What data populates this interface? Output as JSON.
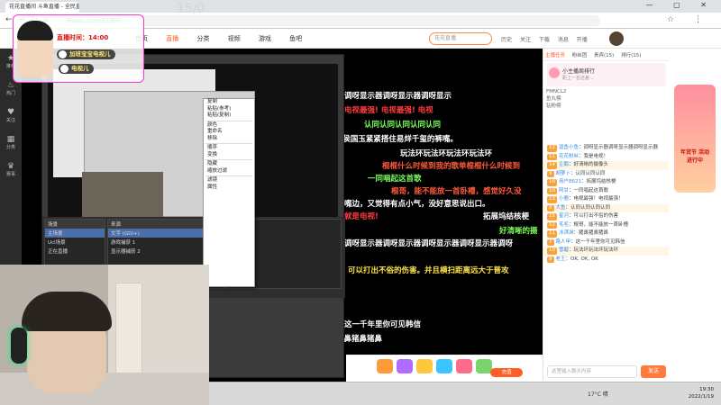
{
  "browser": {
    "tab_title": "花花直播间 斗鱼直播 - 全民直播",
    "url": "douyu.com/12306",
    "controls": "— ▢ ✕"
  },
  "site": {
    "logo": "斗鱼",
    "nav": [
      "首页",
      "直播",
      "分类",
      "视频",
      "游戏",
      "鱼吧"
    ],
    "search_placeholder": "花花直播",
    "header_icons": [
      "历史",
      "关注",
      "下载",
      "消息",
      "开播"
    ]
  },
  "rail": [
    "推荐",
    "热门",
    "关注",
    "分类",
    "赛事"
  ],
  "overlay": {
    "counter": "15/0",
    "time_label": "直播时间：14:00",
    "pill1": "加班宝宝电视儿",
    "pill2": "电视儿"
  },
  "danmu": [
    {
      "text": "调呀显示器调呀显示器调呀显示",
      "color": "#ffffff"
    },
    {
      "text": "电视最强! 电视最强! 电视",
      "color": "#ff3b3b"
    },
    {
      "text": "认同认同认同认同认同",
      "color": "#7cfc5c"
    },
    {
      "text": "\"侯国玉紧紧搭住易烊千玺的裤嘴。",
      "color": "#ffffff"
    },
    {
      "text": "玩法环玩法环玩法环玩法环",
      "color": "#ffffff"
    },
    {
      "text": "棍棍什么时候到我的歌单棍棍什么时候到",
      "color": "#ff5a3b"
    },
    {
      "text": "一同唱起这首歌",
      "color": "#7cfc5c"
    },
    {
      "text": "棍哥，能不能放一首卧槽，感觉好久没",
      "color": "#ff5a3b"
    },
    {
      "text": "嘴边，又觉得有点小气，没好意思说出口。",
      "color": "#ffffff"
    },
    {
      "text": "就是电视!",
      "color": "#ff3b3b"
    },
    {
      "text": "拓展坞结核梗",
      "color": "#ffffff"
    },
    {
      "text": "好清晰的摄",
      "color": "#7cfc5c"
    },
    {
      "text": "调呀显示器调呀显示器调呀显示器调呀显示器调呀",
      "color": "#ffffff"
    },
    {
      "text": "可以打出不俗的伤害。并且横扫距离远大于普攻",
      "color": "#ffe44d"
    },
    {
      "text": "这一千年里你可见韩信",
      "color": "#ffffff"
    },
    {
      "text": "猪鼻猪鼻猪鼻猪鼻猪鼻猪鼻猪鼻猪鼻猪鼻猪鼻",
      "color": "#ffffff"
    }
  ],
  "obs": {
    "menu_items": [
      "复制",
      "粘贴(参考)",
      "粘贴(复制)",
      "",
      "颜色",
      "重命名",
      "移除",
      "",
      "顺序",
      "变换",
      "",
      "隐藏",
      "缩放过滤",
      "",
      "滤镜",
      "属性"
    ],
    "scenes_title": "场景",
    "scenes": [
      "主场景",
      "Ucl场景",
      "正在直播"
    ],
    "sources_title": "来源",
    "sources": [
      "文字 (GDI+)",
      "游戏捕获 1",
      "显示器捕获 2"
    ]
  },
  "gifts": {
    "recharge": "充值"
  },
  "chat": {
    "tabs": [
      "主播任务",
      "粉丝团",
      "贵宾(15)",
      "排行(15)"
    ],
    "rank_title": "小主播周排行",
    "rank_sub": "距上一名还差...",
    "fans": [
      "FMNCL2",
      "鱼丸榜",
      "钻粉榜"
    ],
    "messages": [
      {
        "lv": "12",
        "user": "逗鱼小鱼",
        "text": "调呀显示器调呀显示器调呀显示器"
      },
      {
        "lv": "11",
        "user": "花花粉丝",
        "text": "我是电视！"
      },
      {
        "lv": "14",
        "user": "企鹅",
        "text": "好清晰的摄像头"
      },
      {
        "lv": "9",
        "user": "胡萝卜",
        "text": "认同认同认同"
      },
      {
        "lv": "16",
        "user": "用户8621",
        "text": "拓展坞结核梗"
      },
      {
        "lv": "10",
        "user": "阿甘",
        "text": "一同唱起这首歌"
      },
      {
        "lv": "13",
        "user": "小鹿",
        "text": "电视最强！电视最强！"
      },
      {
        "lv": "8",
        "user": "大鱼",
        "text": "认同认同认同认同"
      },
      {
        "lv": "15",
        "user": "星河",
        "text": "可以打出不俗的伤害"
      },
      {
        "lv": "12",
        "user": "毛毛",
        "text": "棍哥，能不能放一首卧槽"
      },
      {
        "lv": "11",
        "user": "冰淇淋",
        "text": "猪鼻猪鼻猪鼻"
      },
      {
        "lv": "7",
        "user": "路人甲",
        "text": "这一千年里你可见韩信"
      },
      {
        "lv": "10",
        "user": "雪碧",
        "text": "玩法环玩法环玩法环"
      },
      {
        "lv": "9",
        "user": "老王",
        "text": "OK, OK, OK"
      }
    ],
    "input_placeholder": "这里输入聊天内容",
    "send": "发送"
  },
  "ad": {
    "label": "年货节 活动进行中"
  },
  "taskbar": {
    "weather": "17°C 晴",
    "time": "19:30",
    "date": "2022/1/19"
  }
}
